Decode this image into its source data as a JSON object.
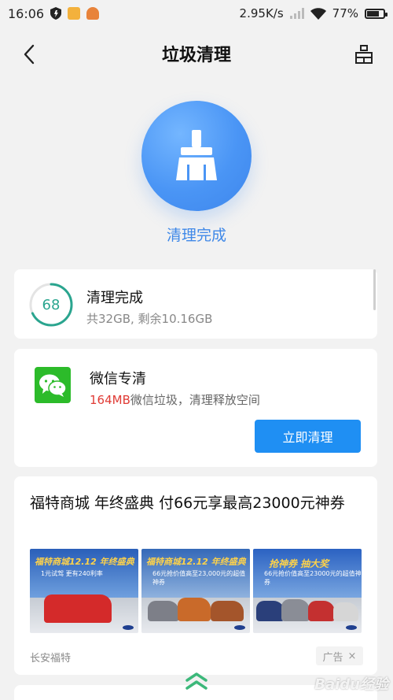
{
  "status_bar": {
    "time": "16:06",
    "network_speed": "2.95K/s",
    "battery_percent": "77%",
    "battery_level": 0.77,
    "icons": [
      "shield-icon",
      "app-notification-icon",
      "app-notification-icon",
      "signal-icon",
      "wifi-icon",
      "battery-icon"
    ]
  },
  "header": {
    "title": "垃圾清理",
    "back_icon": "back-arrow-icon",
    "right_icon": "clean-tool-icon"
  },
  "hero": {
    "icon": "broom-icon",
    "status_label": "清理完成",
    "accent_color": "#4a95f5"
  },
  "storage_card": {
    "score": "68",
    "score_fraction": 0.68,
    "title": "清理完成",
    "subtitle": "共32GB, 剩余10.16GB",
    "ring_color": "#2aa58f"
  },
  "wechat_card": {
    "icon": "wechat-icon",
    "title": "微信专清",
    "size_highlight": "164MB",
    "description": "微信垃圾，清理释放空间",
    "button_label": "立即清理",
    "highlight_color": "#e03b35",
    "button_color": "#1f8ff3"
  },
  "ad_card": {
    "title": "福特商城 年终盛典 付66元享最高23000元神券",
    "images": [
      {
        "headline": "福特商城12.12 年终盛典",
        "subline": "1元试驾 更有240利率"
      },
      {
        "headline": "福特商城12.12 年终盛典",
        "subline": "66元抢价值高至23,000元的超值神券"
      },
      {
        "headline": "抢神券 抽大奖",
        "subline": "66元抢价值高至23000元的超值神券"
      }
    ],
    "source": "长安福特",
    "ad_label": "广告",
    "close_symbol": "×"
  },
  "watermark": "Baidu经验"
}
